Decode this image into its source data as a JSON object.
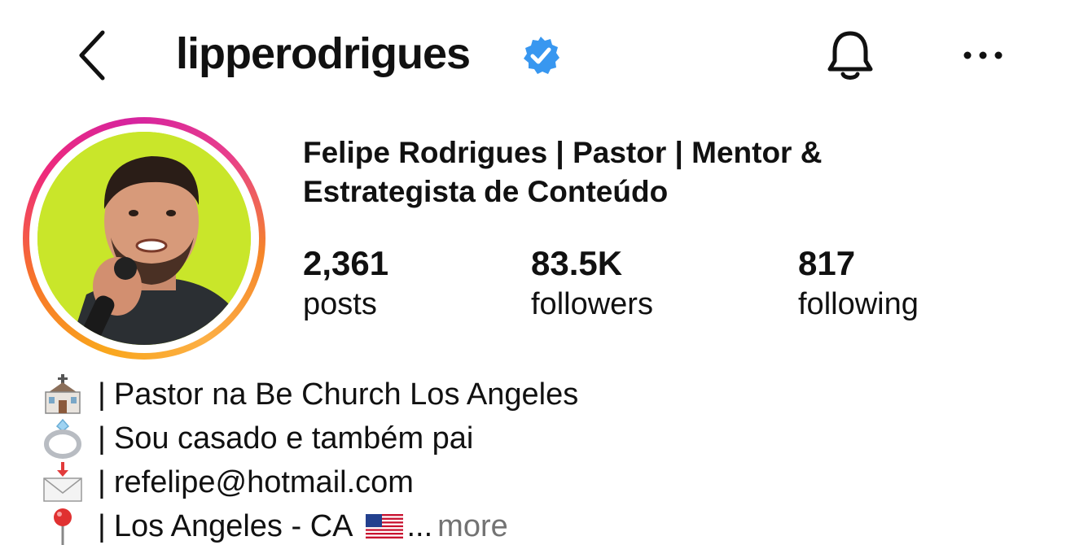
{
  "header": {
    "username": "lipperodrigues",
    "verified": true,
    "icons": {
      "back": "chevron-left-icon",
      "verified": "verified-badge-icon",
      "notifications": "bell-icon",
      "more": "ellipsis-icon"
    }
  },
  "profile": {
    "full_name": "Felipe Rodrigues | Pastor | Mentor & Estrategista de Conteúdo",
    "avatar": "profile-photo",
    "stats": {
      "posts": {
        "count": "2,361",
        "label": "posts"
      },
      "followers": {
        "count": "83.5K",
        "label": "followers"
      },
      "following": {
        "count": "817",
        "label": "following"
      }
    }
  },
  "bio": {
    "lines": [
      {
        "icon": "church-icon",
        "separator": "|",
        "text": "Pastor na Be Church Los Angeles"
      },
      {
        "icon": "ring-icon",
        "separator": "|",
        "text": "Sou casado e também pai"
      },
      {
        "icon": "envelope-icon",
        "separator": "|",
        "text": "refelipe@hotmail.com"
      },
      {
        "icon": "pin-icon",
        "separator": "|",
        "text": "Los Angeles - CA",
        "flag": "us-flag-icon",
        "ellipsis": "...",
        "more": "more"
      }
    ]
  },
  "colors": {
    "text": "#111111",
    "muted": "#737373",
    "verified": "#3897f0",
    "story_ring_start": "#f9a61c",
    "story_ring_end": "#d6249f",
    "avatar_background": "#c9e62a"
  }
}
